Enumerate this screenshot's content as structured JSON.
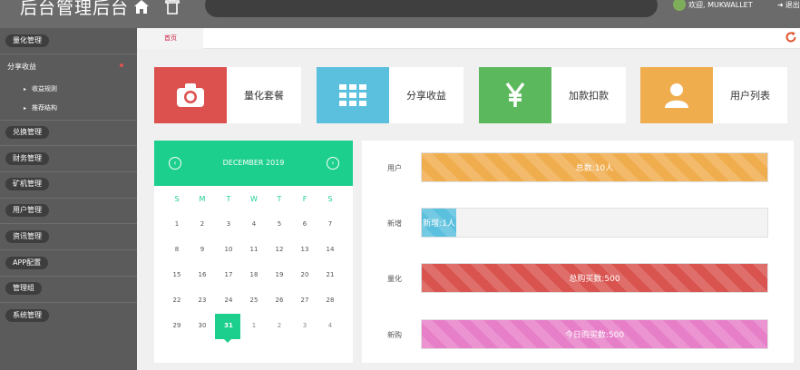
{
  "header": {
    "title": "后台管理后台",
    "welcome": "欢迎, MUKWALLET",
    "logout": "退出"
  },
  "sidebar": {
    "groups": [
      {
        "label": "量化管理",
        "top": 0
      },
      {
        "label": "分享收益",
        "plain": true,
        "children": [
          "收益规则",
          "推荐结构"
        ]
      },
      {
        "label": "兑换管理"
      },
      {
        "label": "财务管理"
      },
      {
        "label": "矿机管理"
      },
      {
        "label": "用户管理"
      },
      {
        "label": "资讯管理"
      },
      {
        "label": "APP配置"
      },
      {
        "label": "管理组"
      },
      {
        "label": "系统管理"
      }
    ]
  },
  "tabs": {
    "home": "首页"
  },
  "tiles": [
    {
      "label": "量化套餐",
      "icon": "camera-icon",
      "color": "#dc514e"
    },
    {
      "label": "分享收益",
      "icon": "grid-icon",
      "color": "#5bc0de"
    },
    {
      "label": "加款扣款",
      "icon": "yen-icon",
      "color": "#5cb85c"
    },
    {
      "label": "用户列表",
      "icon": "user-icon",
      "color": "#f0ad4e"
    }
  ],
  "calendar": {
    "month": "DECEMBER 2019",
    "weekdays": [
      "S",
      "M",
      "T",
      "W",
      "T",
      "F",
      "S"
    ],
    "weeks": [
      [
        "1",
        "2",
        "3",
        "4",
        "5",
        "6",
        "7"
      ],
      [
        "8",
        "9",
        "10",
        "11",
        "12",
        "13",
        "14"
      ],
      [
        "15",
        "16",
        "17",
        "18",
        "19",
        "20",
        "21"
      ],
      [
        "22",
        "23",
        "24",
        "25",
        "26",
        "27",
        "28"
      ],
      [
        "29",
        "30",
        "31",
        "1",
        "2",
        "3",
        "4"
      ]
    ],
    "today": "31"
  },
  "stats": [
    {
      "label": "用户",
      "text": "总数:10人",
      "fill": 1.0,
      "color": "#f0ad4e"
    },
    {
      "label": "新增",
      "text": "新增:1人",
      "fill": 0.1,
      "color": "#5bc0de"
    },
    {
      "label": "量化",
      "text": "总购买数:500",
      "fill": 1.0,
      "color": "#d9534f"
    },
    {
      "label": "新购",
      "text": "今日购买数:500",
      "fill": 1.0,
      "color": "#e77fc8"
    }
  ]
}
